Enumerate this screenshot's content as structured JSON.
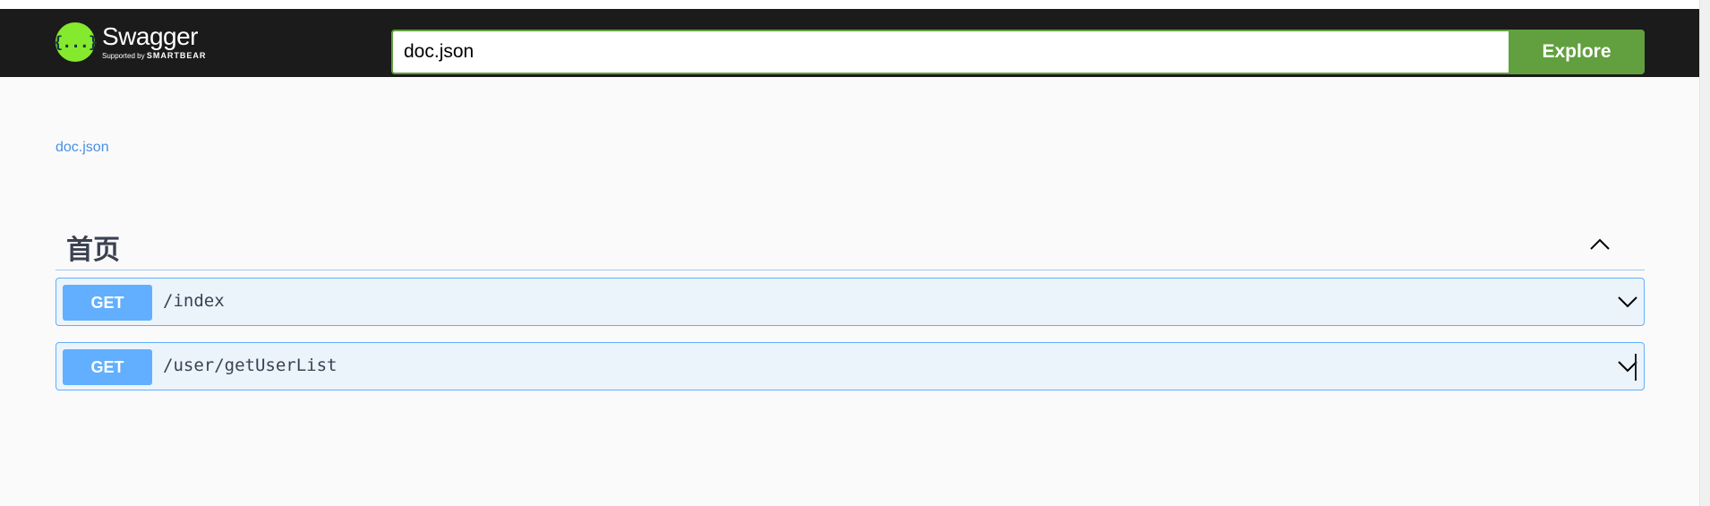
{
  "header": {
    "logo": {
      "glyph": "{...}",
      "title": "Swagger",
      "supported_by": "Supported by",
      "company": "SMARTBEAR"
    },
    "url_input": {
      "value": "doc.json"
    },
    "explore_label": "Explore"
  },
  "spec_link": "doc.json",
  "section": {
    "title": "首页",
    "expanded": true
  },
  "operations": [
    {
      "method": "GET",
      "path": "/index"
    },
    {
      "method": "GET",
      "path": "/user/getUserList"
    }
  ],
  "colors": {
    "topbar": "#1b1b1b",
    "accent_green": "#62a03f",
    "logo_green": "#85ea2d",
    "get_blue": "#61affe",
    "op_bg": "#ebf3fb",
    "link_blue": "#4990e2"
  }
}
